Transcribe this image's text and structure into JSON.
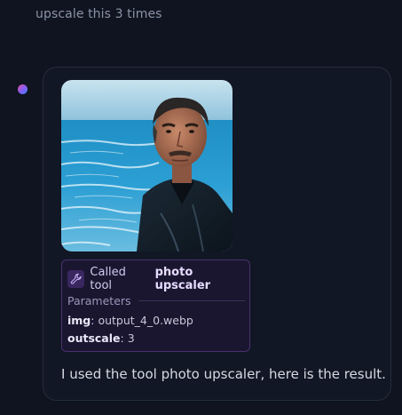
{
  "user_message": "upscale this 3 times",
  "assistant": {
    "image_alt": "Man in leather jacket in front of the ocean",
    "tool_call": {
      "called_prefix": "Called tool",
      "tool_name": "photo upscaler",
      "parameters_label": "Parameters",
      "params": [
        {
          "key": "img",
          "value": "output_4_0.webp"
        },
        {
          "key": "outscale",
          "value": "3"
        }
      ]
    },
    "result_text": "I used the tool photo upscaler, here is the result."
  },
  "colors": {
    "background": "#0f1420",
    "bubble_border": "#262d3b",
    "tool_card_border": "#4a2f6e",
    "tool_card_bg": "#1a1630"
  },
  "icons": {
    "avatar": "gradient-dot",
    "tool": "wrench-icon"
  }
}
